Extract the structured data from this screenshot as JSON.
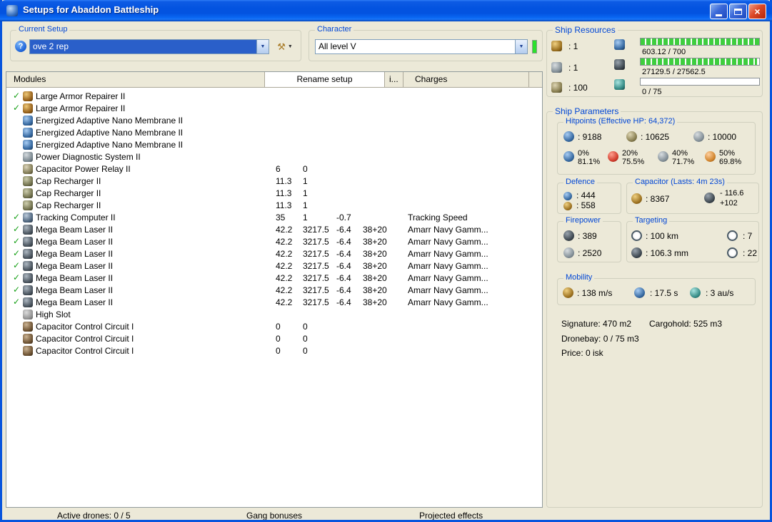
{
  "window": {
    "title": "Setups for Abaddon Battleship"
  },
  "toolbar": {
    "current_setup_label": "Current Setup",
    "current_setup_value": "ove 2 rep",
    "character_label": "Character",
    "character_value": "All level V"
  },
  "ship_resources": {
    "label": "Ship Resources",
    "turrets": ": 1",
    "launchers": ": 1",
    "rigs": ": 100",
    "cpu_text": "603.12 / 700",
    "cpu_fill": 100,
    "powergrid_text": "27129.5 / 27562.5",
    "powergrid_fill": 98,
    "dronebay_text": "0 / 75",
    "dronebay_fill": 0
  },
  "modules_panel": {
    "tabs": [
      {
        "label": "Modules"
      },
      {
        "label": "Rename setup"
      },
      {
        "label": "i..."
      },
      {
        "label": "Charges"
      }
    ],
    "rows": [
      {
        "check": true,
        "icon": "armor-repairer-icon",
        "name": "Large Armor Repairer II",
        "c1": "",
        "c2": "",
        "c3": "",
        "c4": "",
        "c5": ""
      },
      {
        "check": true,
        "icon": "armor-repairer-icon",
        "name": "Large Armor Repairer II",
        "c1": "",
        "c2": "",
        "c3": "",
        "c4": "",
        "c5": ""
      },
      {
        "check": false,
        "icon": "nano-membrane-icon",
        "name": "Energized Adaptive Nano Membrane II",
        "c1": "",
        "c2": "",
        "c3": "",
        "c4": "",
        "c5": ""
      },
      {
        "check": false,
        "icon": "nano-membrane-icon",
        "name": "Energized Adaptive Nano Membrane II",
        "c1": "",
        "c2": "",
        "c3": "",
        "c4": "",
        "c5": ""
      },
      {
        "check": false,
        "icon": "nano-membrane-icon",
        "name": "Energized Adaptive Nano Membrane II",
        "c1": "",
        "c2": "",
        "c3": "",
        "c4": "",
        "c5": ""
      },
      {
        "check": false,
        "icon": "power-diagnostic-icon",
        "name": "Power Diagnostic System II",
        "c1": "",
        "c2": "",
        "c3": "",
        "c4": "",
        "c5": ""
      },
      {
        "check": false,
        "icon": "cap-power-relay-icon",
        "name": "Capacitor Power Relay II",
        "c1": "6",
        "c2": "0",
        "c3": "",
        "c4": "",
        "c5": ""
      },
      {
        "check": false,
        "icon": "cap-recharger-icon",
        "name": "Cap Recharger II",
        "c1": "11.3",
        "c2": "1",
        "c3": "",
        "c4": "",
        "c5": ""
      },
      {
        "check": false,
        "icon": "cap-recharger-icon",
        "name": "Cap Recharger II",
        "c1": "11.3",
        "c2": "1",
        "c3": "",
        "c4": "",
        "c5": ""
      },
      {
        "check": false,
        "icon": "cap-recharger-icon",
        "name": "Cap Recharger II",
        "c1": "11.3",
        "c2": "1",
        "c3": "",
        "c4": "",
        "c5": ""
      },
      {
        "check": true,
        "icon": "tracking-computer-icon",
        "name": "Tracking Computer II",
        "c1": "35",
        "c2": "1",
        "c3": "-0.7",
        "c4": "",
        "c5": "Tracking Speed"
      },
      {
        "check": true,
        "icon": "beam-laser-icon",
        "name": "Mega Beam Laser II",
        "c1": "42.2",
        "c2": "3217.5",
        "c3": "-6.4",
        "c4": "38+20",
        "c5": "Amarr Navy Gamm..."
      },
      {
        "check": true,
        "icon": "beam-laser-icon",
        "name": "Mega Beam Laser II",
        "c1": "42.2",
        "c2": "3217.5",
        "c3": "-6.4",
        "c4": "38+20",
        "c5": "Amarr Navy Gamm..."
      },
      {
        "check": true,
        "icon": "beam-laser-icon",
        "name": "Mega Beam Laser II",
        "c1": "42.2",
        "c2": "3217.5",
        "c3": "-6.4",
        "c4": "38+20",
        "c5": "Amarr Navy Gamm..."
      },
      {
        "check": true,
        "icon": "beam-laser-icon",
        "name": "Mega Beam Laser II",
        "c1": "42.2",
        "c2": "3217.5",
        "c3": "-6.4",
        "c4": "38+20",
        "c5": "Amarr Navy Gamm..."
      },
      {
        "check": true,
        "icon": "beam-laser-icon",
        "name": "Mega Beam Laser II",
        "c1": "42.2",
        "c2": "3217.5",
        "c3": "-6.4",
        "c4": "38+20",
        "c5": "Amarr Navy Gamm..."
      },
      {
        "check": true,
        "icon": "beam-laser-icon",
        "name": "Mega Beam Laser II",
        "c1": "42.2",
        "c2": "3217.5",
        "c3": "-6.4",
        "c4": "38+20",
        "c5": "Amarr Navy Gamm..."
      },
      {
        "check": true,
        "icon": "beam-laser-icon",
        "name": "Mega Beam Laser II",
        "c1": "42.2",
        "c2": "3217.5",
        "c3": "-6.4",
        "c4": "38+20",
        "c5": "Amarr Navy Gamm..."
      },
      {
        "check": false,
        "icon": "high-slot-icon",
        "name": "High Slot",
        "c1": "",
        "c2": "",
        "c3": "",
        "c4": "",
        "c5": ""
      },
      {
        "check": false,
        "icon": "capacitor-circuit-icon",
        "name": "Capacitor Control Circuit I",
        "c1": "0",
        "c2": "0",
        "c3": "",
        "c4": "",
        "c5": ""
      },
      {
        "check": false,
        "icon": "capacitor-circuit-icon",
        "name": "Capacitor Control Circuit I",
        "c1": "0",
        "c2": "0",
        "c3": "",
        "c4": "",
        "c5": ""
      },
      {
        "check": false,
        "icon": "capacitor-circuit-icon",
        "name": "Capacitor Control Circuit I",
        "c1": "0",
        "c2": "0",
        "c3": "",
        "c4": "",
        "c5": ""
      }
    ]
  },
  "ship_parameters": {
    "label": "Ship Parameters",
    "hitpoints": {
      "label": "Hitpoints (Effective HP: 64,372)",
      "shield": ": 9188",
      "armor": ": 10625",
      "structure": ": 10000",
      "resists": [
        {
          "name": "em",
          "top": "0%",
          "bottom": "81.1%"
        },
        {
          "name": "thermal",
          "top": "20%",
          "bottom": "75.5%"
        },
        {
          "name": "kinetic",
          "top": "40%",
          "bottom": "71.7%"
        },
        {
          "name": "explosive",
          "top": "50%",
          "bottom": "69.8%"
        }
      ]
    },
    "defence": {
      "label": "Defence",
      "shield_recharge": ": 444",
      "armor_repair": ": 558"
    },
    "capacitor": {
      "label": "Capacitor (Lasts: 4m 23s)",
      "amount": ": 8367",
      "drain": "- 116.6",
      "recharge": "+102"
    },
    "firepower": {
      "label": "Firepower",
      "volley": ": 389",
      "dps": ": 2520"
    },
    "targeting": {
      "label": "Targeting",
      "range": ": 100 km",
      "scan_resolution": ": 106.3 mm",
      "max_targets": ": 7",
      "sensor_strength": ": 22"
    },
    "mobility": {
      "label": "Mobility",
      "velocity": ": 138 m/s",
      "align_time": ": 17.5 s",
      "warp_speed": ": 3 au/s"
    },
    "summary": {
      "signature": "Signature: 470 m2",
      "cargohold": "Cargohold: 525 m3",
      "dronebay": "Dronebay: 0 / 75 m3",
      "price": "Price: 0 isk"
    }
  },
  "status_bar": {
    "active_drones": "Active drones: 0 / 5",
    "gang_bonuses": "Gang bonuses",
    "projected_effects": "Projected effects"
  }
}
